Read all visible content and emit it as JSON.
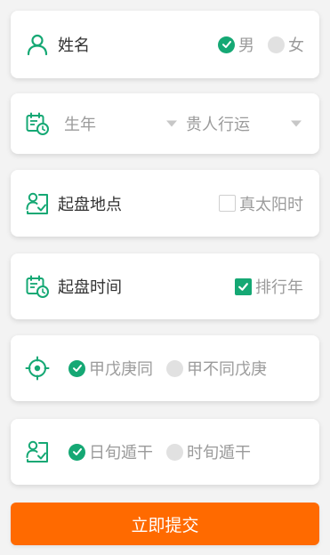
{
  "colors": {
    "accent_green": "#15a874",
    "submit_orange": "#ff6a00",
    "muted_text": "#9b9b9b"
  },
  "name_row": {
    "icon": "person-icon",
    "label": "姓名",
    "gender_options": [
      {
        "label": "男",
        "selected": true
      },
      {
        "label": "女",
        "selected": false
      }
    ]
  },
  "year_row": {
    "icon": "calendar-clock-icon",
    "year_select": "生年",
    "luck_select": "贵人行运"
  },
  "place_row": {
    "icon": "person-card-icon",
    "label": "起盘地点",
    "true_solar_time": {
      "label": "真太阳时",
      "checked": false
    }
  },
  "time_row": {
    "icon": "calendar-clock-icon",
    "label": "起盘时间",
    "rank_year": {
      "label": "排行年",
      "checked": true
    }
  },
  "method_row": {
    "icon": "target-icon",
    "options": [
      {
        "label": "甲戊庚同",
        "selected": true
      },
      {
        "label": "甲不同戊庚",
        "selected": false
      }
    ]
  },
  "dun_row": {
    "icon": "person-card-icon",
    "options": [
      {
        "label": "日旬遁干",
        "selected": true
      },
      {
        "label": "时旬遁干",
        "selected": false
      }
    ]
  },
  "submit_label": "立即提交"
}
